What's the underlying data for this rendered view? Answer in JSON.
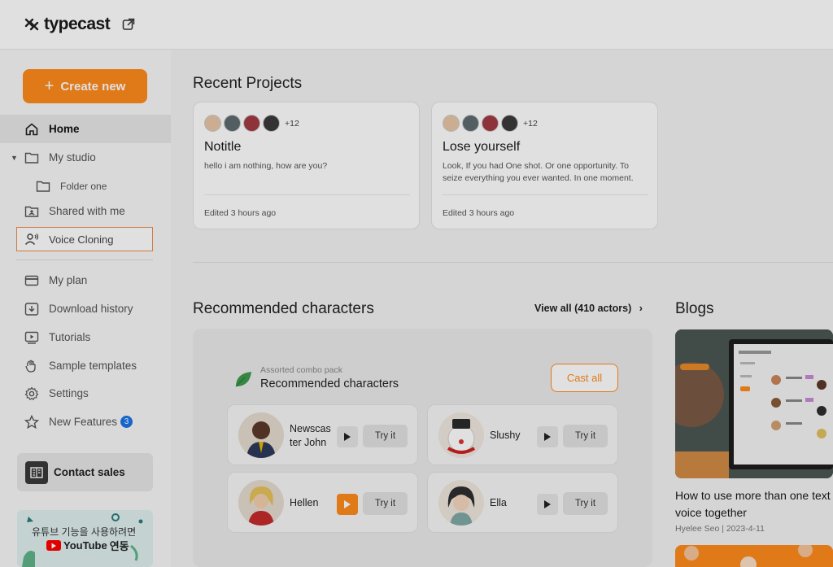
{
  "app": {
    "name": "typecast"
  },
  "sidebar": {
    "create_label": "Create new",
    "items": [
      {
        "label": "Home"
      },
      {
        "label": "My studio"
      },
      {
        "label": "Folder one"
      },
      {
        "label": "Shared with me"
      },
      {
        "label": "Voice Cloning"
      },
      {
        "label": "My plan"
      },
      {
        "label": "Download history"
      },
      {
        "label": "Tutorials"
      },
      {
        "label": "Sample templates"
      },
      {
        "label": "Settings"
      },
      {
        "label": "New Features",
        "badge": "3"
      }
    ],
    "contact_label": "Contact sales",
    "banner": {
      "line1": "유튜브 기능을 사용하려면",
      "brand": "YouTube",
      "line2": "연동"
    }
  },
  "recent": {
    "heading": "Recent Projects",
    "projects": [
      {
        "more": "+12",
        "title": "Notitle",
        "desc": "hello i am nothing, how are you?",
        "edited": "Edited 3 hours ago"
      },
      {
        "more": "+12",
        "title": "Lose yourself",
        "desc": "Look, If you had One shot. Or one opportunity. To seize everything you ever wanted. In one moment.",
        "edited": "Edited 3 hours ago"
      }
    ]
  },
  "recommended": {
    "heading": "Recommended characters",
    "view_all": "View all (410 actors)",
    "pack_sub": "Assorted combo pack",
    "pack_title": "Recommended characters",
    "cast_all": "Cast all",
    "try_label": "Try it",
    "characters": [
      {
        "name_l1": "Newscas",
        "name_l2": "ter John"
      },
      {
        "name_l1": "Slushy"
      },
      {
        "name_l1": "Hellen"
      },
      {
        "name_l1": "Ella"
      }
    ]
  },
  "blogs": {
    "heading": "Blogs",
    "post_title_l1": "How to use more than one text",
    "post_title_l2": "voice together",
    "post_meta": "Hyelee Seo | 2023-4-11"
  },
  "colors": {
    "accent": "#ff8a1c",
    "badge": "#1a73e8",
    "highlight_border": "#f08a4b"
  }
}
